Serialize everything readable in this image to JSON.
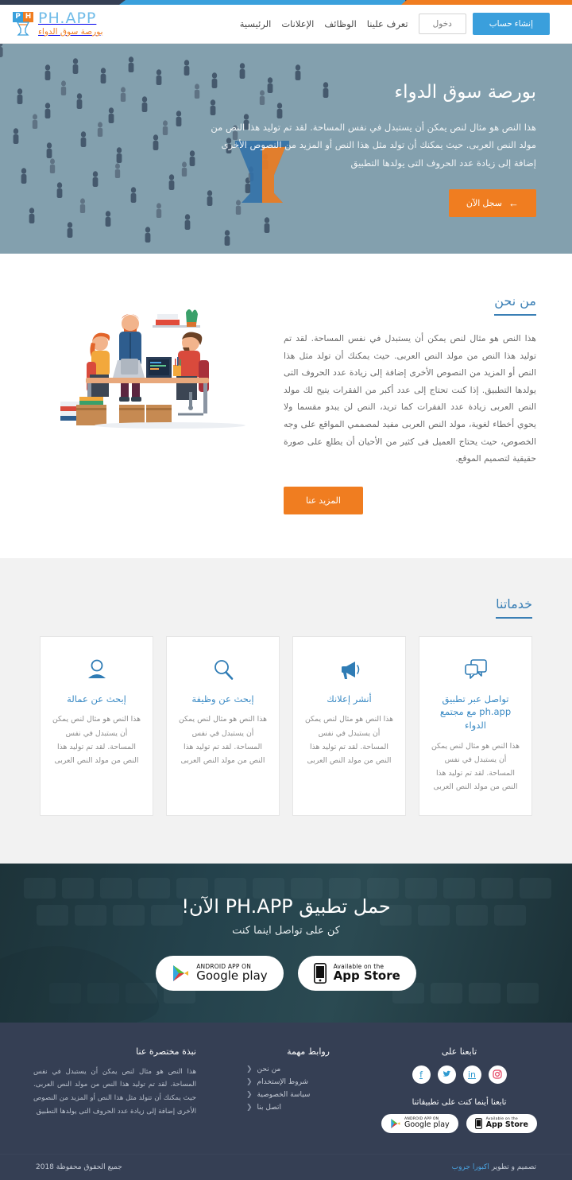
{
  "theme": {
    "blue": "#3a9fdc",
    "orange": "#f07d20",
    "navy": "#353f54",
    "hero_bg": "#83a0ae",
    "section_bg": "#f2f2f2",
    "heading_blue": "#3a7fb5"
  },
  "header": {
    "brand": {
      "name": "PH.APP",
      "tagline": "بورصة سوق الدواء",
      "mark_p": "P",
      "mark_h": "H"
    },
    "nav": [
      {
        "label": "الرئيسية"
      },
      {
        "label": "الإعلانات"
      },
      {
        "label": "الوظائف"
      },
      {
        "label": "تعرف علينا"
      }
    ],
    "login_label": "دخول",
    "signup_label": "إنشاء حساب"
  },
  "hero": {
    "title": "بورصة سوق الدواء",
    "text": "هذا النص هو مثال لنص يمكن أن يستبدل في نفس المساحة. لقد تم توليد هذا النص من مولد النص العربى. حيث يمكنك أن تولد مثل هذا النص أو المزيد من النصوص الأخرى إضافة إلى زيادة عدد الحروف التى يولدها التطبيق",
    "cta_label": "سجل الآن",
    "cta_arrow": "arrow-left-icon"
  },
  "about": {
    "heading": "من نحن",
    "text": "هذا النص هو مثال لنص يمكن أن يستبدل في نفس المساحة. لقد تم توليد هذا النص من مولد النص العربى. حيث يمكنك أن تولد مثل هذا النص أو المزيد من النصوص الأخرى إضافة إلى زيادة عدد الحروف التى يولدها التطبيق. إذا كنت تحتاج إلى عدد أكبر من الفقرات يتيح لك مولد النص العربى زيادة عدد الفقرات كما تريد، النص لن يبدو مقسما ولا يحوي أخطاء لغوية، مولد النص العربى مفيد لمصممي المواقع على وجه الخصوص، حيث يحتاج العميل فى كثير من الأحيان أن يطلع على صورة حقيقية لتصميم الموقع.",
    "cta_label": "المزيد عنا",
    "illustration": "team-at-desk-illustration"
  },
  "services": {
    "heading": "خدماتنا",
    "cards": [
      {
        "icon": "person-icon",
        "title": "إبحث عن عمالة",
        "body": "هذا النص هو مثال لنص يمكن أن يستبدل في نفس المساحة. لقد تم توليد هذا النص من مولد النص العربى"
      },
      {
        "icon": "magnifier-icon",
        "title": "إبحث عن وظيفة",
        "body": "هذا النص هو مثال لنص يمكن أن يستبدل في نفس المساحة. لقد تم توليد هذا النص من مولد النص العربى"
      },
      {
        "icon": "megaphone-icon",
        "title": "أنشر إعلانك",
        "body": "هذا النص هو مثال لنص يمكن أن يستبدل في نفس المساحة. لقد تم توليد هذا النص من مولد النص العربى"
      },
      {
        "icon": "chat-bubbles-icon",
        "title": "تواصل عبر تطبيق ph.app مع مجتمع الدواء",
        "body": "هذا النص هو مثال لنص يمكن أن يستبدل في نفس المساحة. لقد تم توليد هذا النص من مولد النص العربى"
      }
    ]
  },
  "download": {
    "title": "حمل تطبيق PH.APP الآن!",
    "subtitle": "كن على تواصل اينما كنت",
    "appstore": {
      "small": "Available on the",
      "big": "App Store",
      "icon": "apple-phone-icon"
    },
    "googleplay": {
      "small": "ANDROID APP ON",
      "big": "Google play",
      "icon": "google-play-triangle-icon"
    }
  },
  "footer": {
    "about_heading": "نبذة مختصرة عنا",
    "about_text": "هذا النص هو مثال لنص يمكن أن يستبدل في نفس المساحة. لقد تم توليد هذا النص من مولد النص العربى. حيث يمكنك أن تتولد مثل هذا النص أو المزيد من النصوص الأخرى إضافة إلى زيادة عدد الحروف التى يولدها التطبيق",
    "links_heading": "روابط مهمة",
    "links": [
      {
        "label": "من نحن"
      },
      {
        "label": "شروط الإستخدام"
      },
      {
        "label": "سياسة الخصوصية"
      },
      {
        "label": "اتصل بنا"
      }
    ],
    "follow_heading": "تابعنا على",
    "social": [
      {
        "name": "instagram-icon",
        "glyph": "▢"
      },
      {
        "name": "linkedin-icon",
        "glyph": "in"
      },
      {
        "name": "twitter-icon",
        "glyph": "ᴠ"
      },
      {
        "name": "facebook-icon",
        "glyph": "f"
      }
    ],
    "apps_heading": "تابعنا أينما كنت على تطبيقاتنا",
    "appstore": {
      "small": "Available on the",
      "big": "App Store"
    },
    "googleplay": {
      "small": "ANDROID APP ON",
      "big": "Google play"
    }
  },
  "copyright": {
    "rights": "جميع الحقوق محفوظة 2018",
    "credit_prefix": "تصميم و تطوير",
    "credit_link": "اكبورا جروب"
  }
}
